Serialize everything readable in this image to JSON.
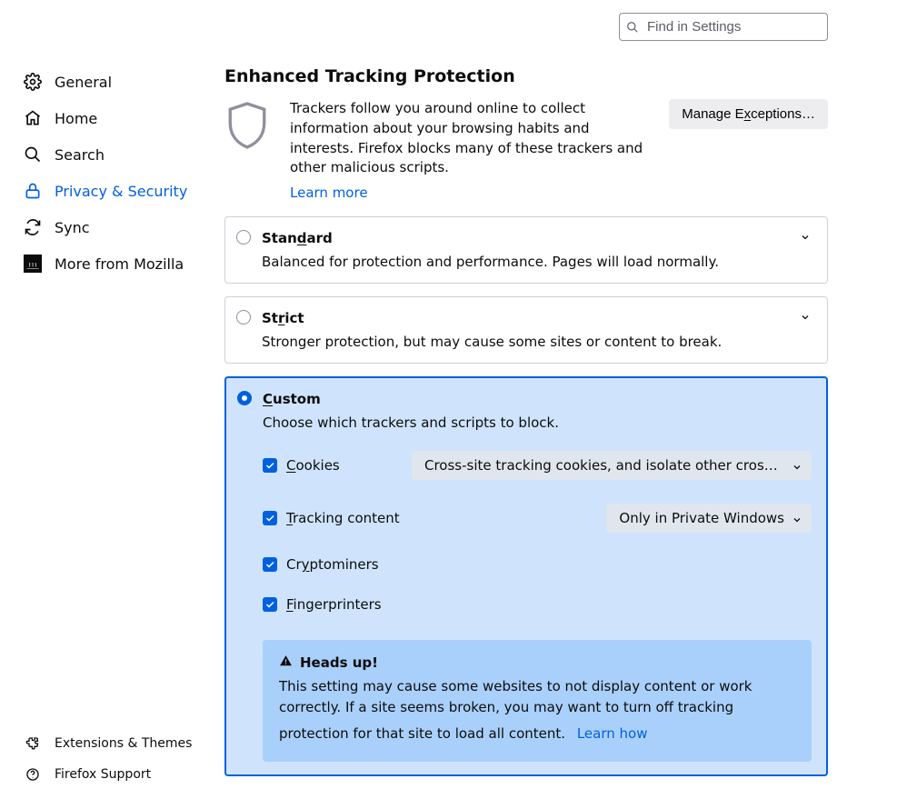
{
  "search": {
    "placeholder": "Find in Settings"
  },
  "sidebar": {
    "items": [
      {
        "label": "General"
      },
      {
        "label": "Home"
      },
      {
        "label": "Search"
      },
      {
        "label": "Privacy & Security"
      },
      {
        "label": "Sync"
      },
      {
        "label": "More from Mozilla"
      }
    ],
    "bottom": [
      {
        "label": "Extensions & Themes"
      },
      {
        "label": "Firefox Support"
      }
    ]
  },
  "section": {
    "title": "Enhanced Tracking Protection",
    "intro": "Trackers follow you around online to collect information about your browsing habits and interests. Firefox blocks many of these trackers and other malicious scripts.",
    "learn_more": "Learn more",
    "manage_exceptions": "Manage Exceptions…",
    "standard": {
      "title_pre": "Stan",
      "title_ul": "d",
      "title_post": "ard",
      "desc": "Balanced for protection and performance. Pages will load normally."
    },
    "strict": {
      "title_pre": "St",
      "title_ul": "r",
      "title_post": "ict",
      "desc": "Stronger protection, but may cause some sites or content to break."
    },
    "custom": {
      "title_ul": "C",
      "title_post": "ustom",
      "desc": "Choose which trackers and scripts to block.",
      "cookies": {
        "ul": "C",
        "post": "ookies",
        "select": "Cross-site tracking cookies, and isolate other cross-site c…"
      },
      "tracking": {
        "ul": "T",
        "post": "racking content",
        "select": "Only in Private Windows"
      },
      "crypto": {
        "pre": "Cr",
        "ul": "y",
        "post": "ptominers"
      },
      "finger": {
        "ul": "F",
        "post": "ingerprinters"
      }
    },
    "notice": {
      "title": "Heads up!",
      "body": "This setting may cause some websites to not display content or work correctly. If a site seems broken, you may want to turn off tracking protection for that site to load all content.",
      "learn_how": "Learn how"
    }
  }
}
